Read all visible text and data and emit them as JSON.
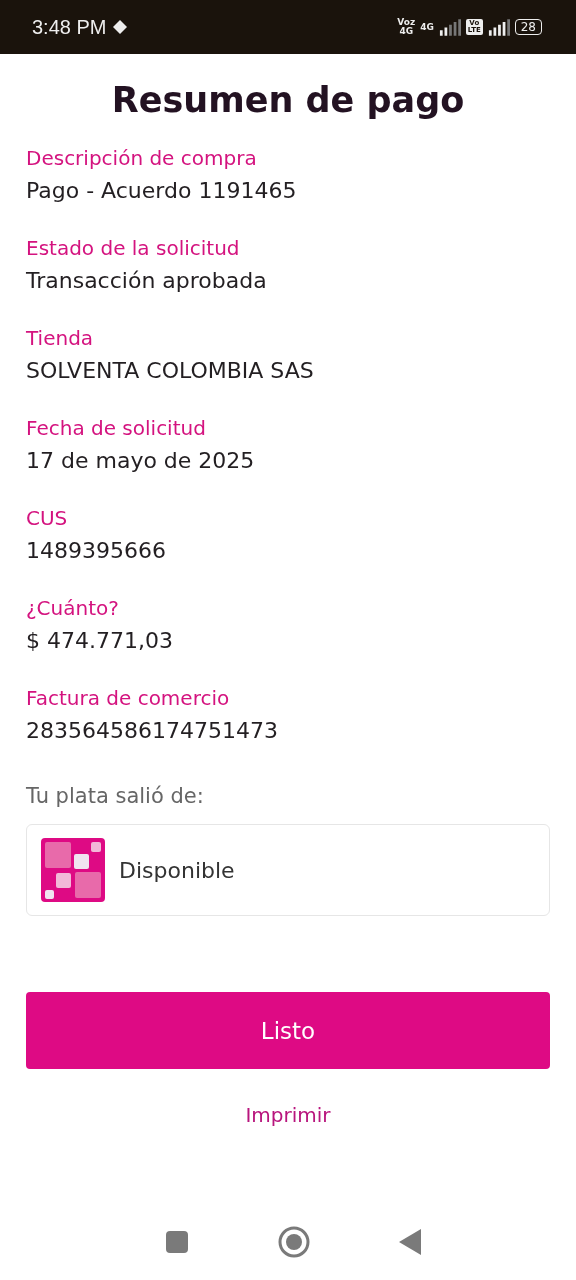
{
  "status_bar": {
    "time": "3:48 PM",
    "network_1": [
      "Voz",
      "4G"
    ],
    "network_2": "4G",
    "volte": [
      "Vo",
      "LTE"
    ],
    "battery": "28"
  },
  "title": "Resumen de pago",
  "fields": [
    {
      "label": "Descripción de compra",
      "value": "Pago - Acuerdo 1191465"
    },
    {
      "label": "Estado de la solicitud",
      "value": "Transacción aprobada"
    },
    {
      "label": "Tienda",
      "value": "SOLVENTA COLOMBIA SAS"
    },
    {
      "label": "Fecha de solicitud",
      "value": "17 de mayo de 2025"
    },
    {
      "label": "CUS",
      "value": "1489395666"
    },
    {
      "label": "¿Cuánto?",
      "value": "$ 474.771,03"
    },
    {
      "label": "Factura de comercio",
      "value": "283564586174751473"
    }
  ],
  "source": {
    "heading": "Tu plata salió de:",
    "account": "Disponible"
  },
  "buttons": {
    "primary": "Listo",
    "link": "Imprimir"
  }
}
